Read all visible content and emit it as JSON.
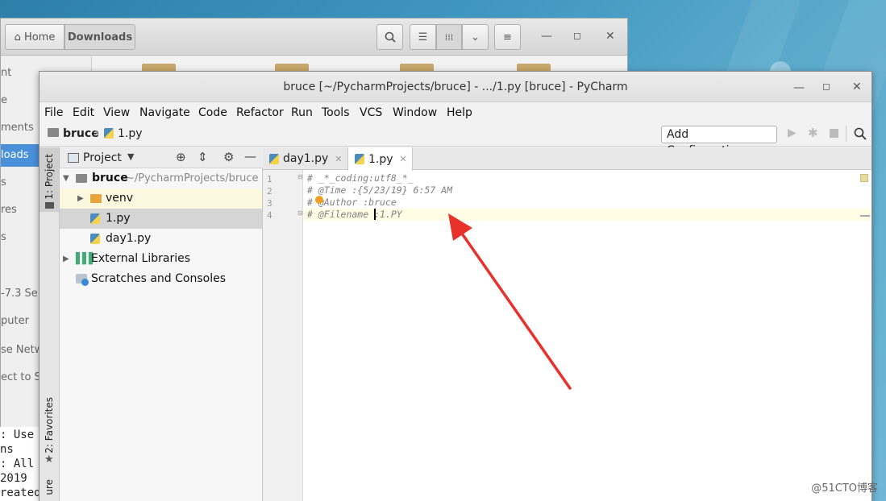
{
  "file_manager": {
    "home_label": "Home",
    "current_folder_label": "Downloads",
    "sidebar": [
      "nt",
      "e",
      "ments",
      "loads",
      "s",
      "res",
      "s",
      "-7.3 Se",
      "puter",
      "se Netw",
      "ect to S"
    ],
    "terminal_lines": [
      ": Use",
      "ns",
      ": All",
      " 2019",
      "reated"
    ]
  },
  "pycharm": {
    "title": "bruce [~/PycharmProjects/bruce] - .../1.py [bruce] - PyCharm",
    "menu": [
      "File",
      "Edit",
      "View",
      "Navigate",
      "Code",
      "Refactor",
      "Run",
      "Tools",
      "VCS",
      "Window",
      "Help"
    ],
    "breadcrumb": {
      "project": "bruce",
      "file": "1.py"
    },
    "add_configuration_label": "Add Configuration...",
    "left_tool_windows": {
      "project": "1: Project",
      "favorites": "2: Favorites",
      "structure": "ure"
    },
    "project_panel": {
      "header": "Project",
      "root_name": "bruce",
      "root_path": "~/PycharmProjects/bruce",
      "items": [
        "venv",
        "1.py",
        "day1.py"
      ],
      "external_libraries": "External Libraries",
      "scratches": "Scratches and Consoles"
    },
    "tabs": [
      {
        "label": "day1.py"
      },
      {
        "label": "1.py"
      }
    ],
    "editor": {
      "line_numbers": [
        "1",
        "2",
        "3",
        "4"
      ],
      "lines": [
        "# _*_coding:utf8_*_",
        "# @Time  :{5/23/19} 6:57 AM",
        "# @Author :bruce",
        "# @Filename :1.PY"
      ]
    }
  },
  "watermark": "@51CTO博客",
  "colors": {
    "arrow": "#e8312a",
    "selection": "#d5d5d5",
    "current_line": "#fffde4",
    "fm_selected": "#4a90d9"
  }
}
